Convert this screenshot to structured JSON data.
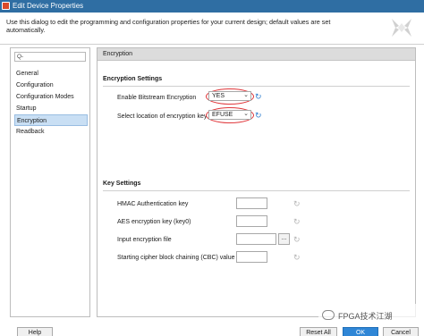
{
  "window": {
    "title": "Edit Device Properties"
  },
  "description": "Use this dialog to edit the programming and configuration properties for your current design; default values are set automatically.",
  "search": {
    "value": "Q-"
  },
  "nav": {
    "items": [
      {
        "label": "General"
      },
      {
        "label": "Configuration"
      },
      {
        "label": "Configuration Modes"
      },
      {
        "label": "Startup"
      },
      {
        "label": "Encryption",
        "selected": true
      },
      {
        "label": "Readback"
      }
    ]
  },
  "panel": {
    "header": "Encryption",
    "encryption_settings": {
      "title": "Encryption Settings",
      "enable_label": "Enable Bitstream Encryption",
      "enable_value": "YES",
      "location_label": "Select location of encryption key",
      "location_value": "EFUSE"
    },
    "key_settings": {
      "title": "Key Settings",
      "hmac_label": "HMAC Authentication key",
      "aes_label": "AES encryption key (key0)",
      "input_file_label": "Input encryption file",
      "browse_label": "...",
      "cbc_label": "Starting cipher block chaining (CBC) value"
    }
  },
  "buttons": {
    "help": "Help",
    "reset_all": "Reset All",
    "ok": "OK",
    "cancel": "Cancel"
  },
  "watermark": {
    "text": "FPGA技术江湖"
  },
  "colors": {
    "titlebar": "#2f6ea3",
    "highlight": "#e0373b",
    "selected_nav": "#c9dff4",
    "primary_button": "#2f86d6"
  },
  "icons": [
    "app-icon",
    "xilinx-logo-icon",
    "refresh-icon",
    "chevron-down-icon",
    "wechat-icon"
  ]
}
